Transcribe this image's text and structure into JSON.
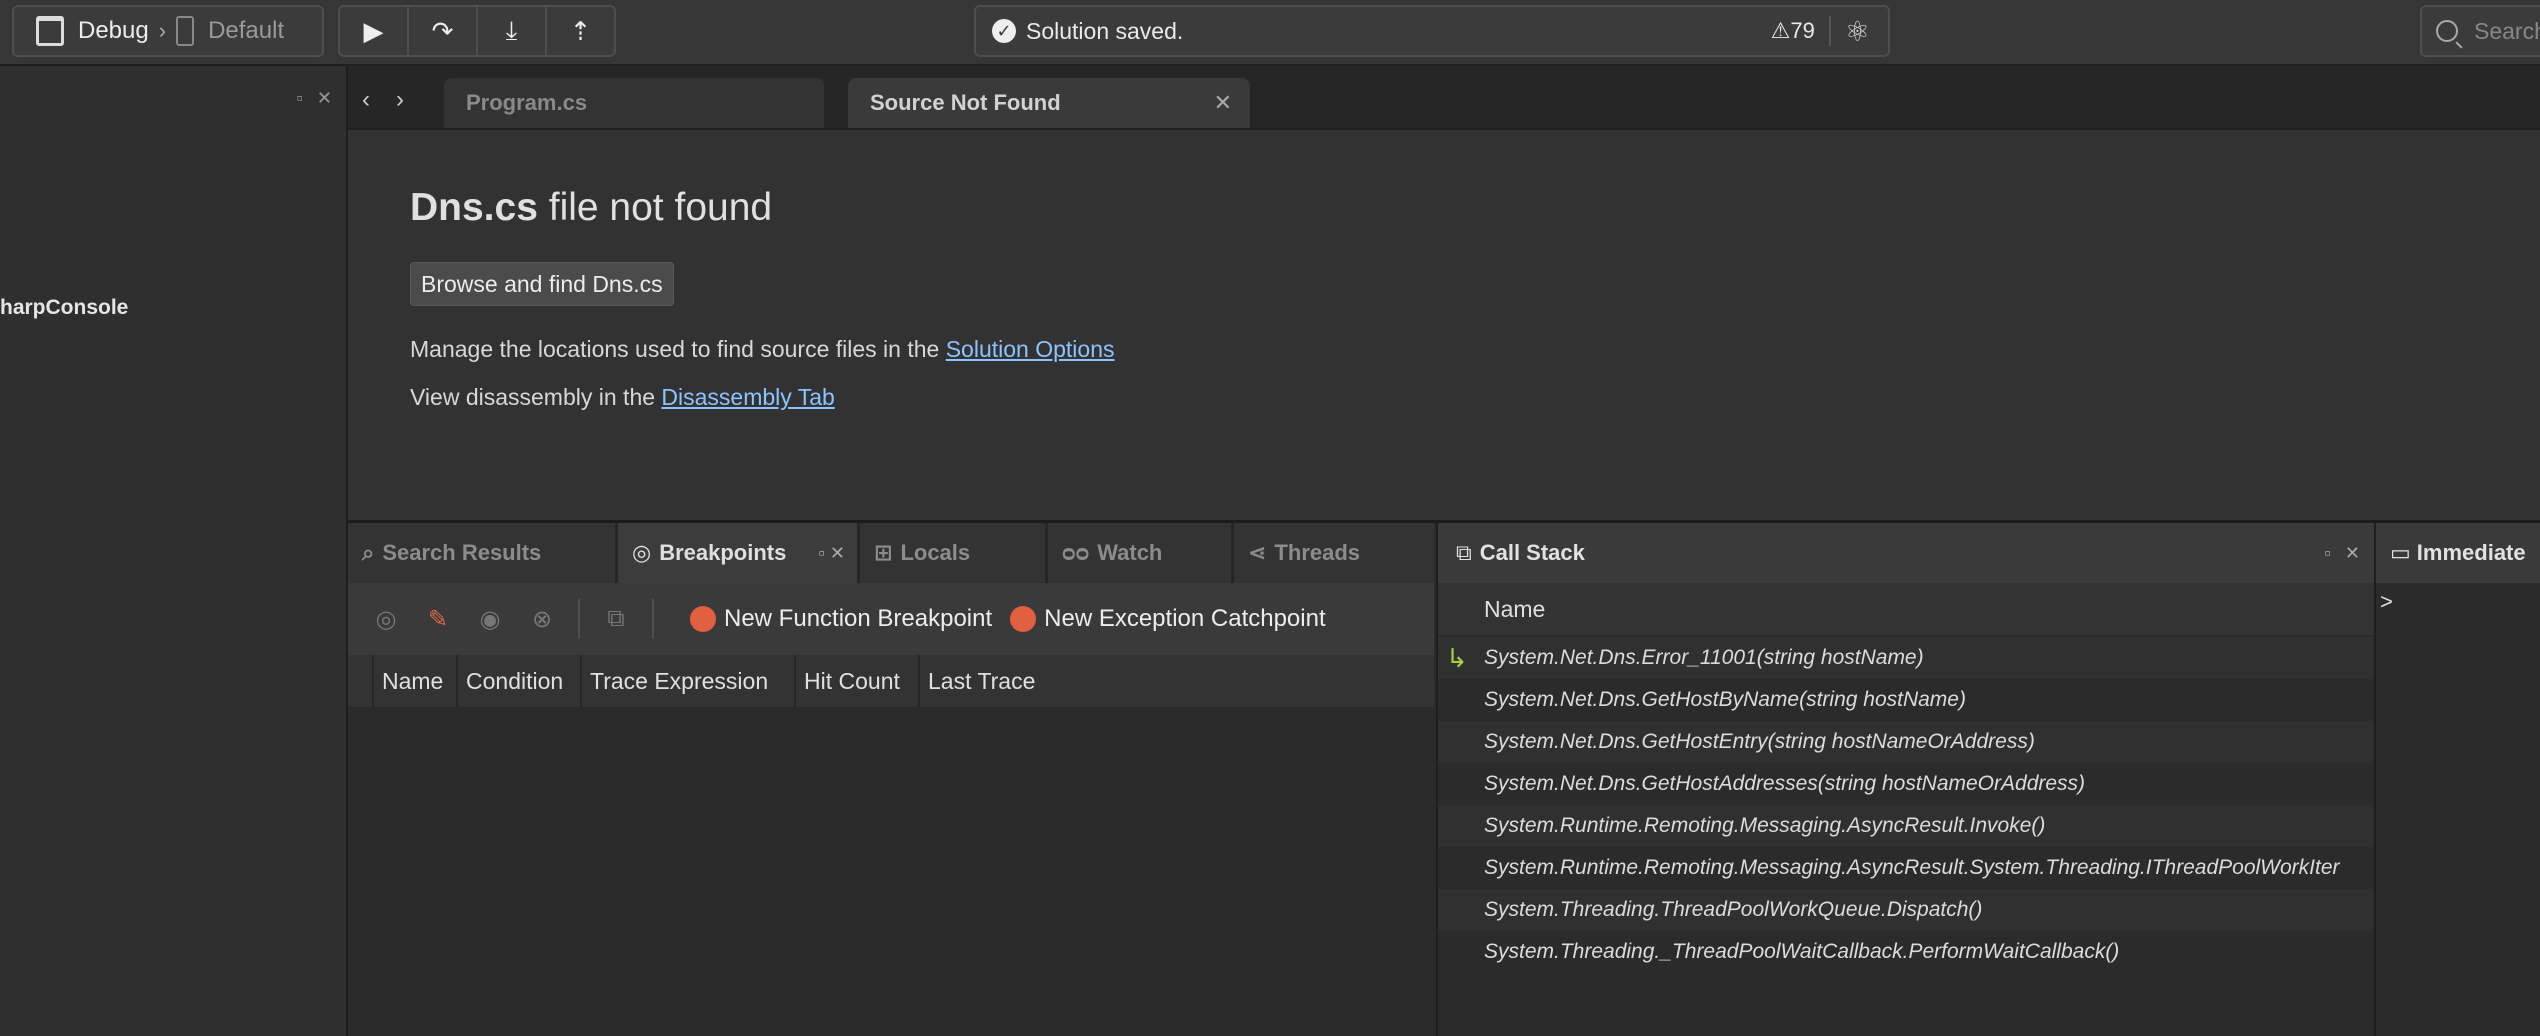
{
  "toolbar": {
    "config": "Debug",
    "device": "Default",
    "status_message": "Solution saved.",
    "warnings_count": "79",
    "search_placeholder": "Search"
  },
  "left_panel": {
    "project_label": "harpConsole"
  },
  "doc_tabs": [
    {
      "label": "Program.cs"
    },
    {
      "label": "Source Not Found"
    }
  ],
  "editor": {
    "filename": "Dns.cs",
    "title_rest": " file not found",
    "browse_button": "Browse and find Dns.cs",
    "manage_text": "Manage the locations used to find source files in the ",
    "manage_link": "Solution Options",
    "disasm_text": "View disassembly in the ",
    "disasm_link": "Disassembly Tab"
  },
  "pad_tabs": [
    {
      "label": "Search Results"
    },
    {
      "label": "Breakpoints"
    },
    {
      "label": "Locals"
    },
    {
      "label": "Watch"
    },
    {
      "label": "Threads"
    }
  ],
  "breakpoints": {
    "new_function": "New Function Breakpoint",
    "new_exception": "New Exception Catchpoint",
    "columns": [
      "Name",
      "Condition",
      "Trace Expression",
      "Hit Count",
      "Last Trace"
    ]
  },
  "call_stack": {
    "title": "Call Stack",
    "column": "Name",
    "frames": [
      "System.Net.Dns.Error_11001(string hostName)",
      "System.Net.Dns.GetHostByName(string hostName)",
      "System.Net.Dns.GetHostEntry(string hostNameOrAddress)",
      "System.Net.Dns.GetHostAddresses(string hostNameOrAddress)",
      "System.Runtime.Remoting.Messaging.AsyncResult.Invoke()",
      "System.Runtime.Remoting.Messaging.AsyncResult.System.Threading.IThreadPoolWorkIter",
      "System.Threading.ThreadPoolWorkQueue.Dispatch()",
      "System.Threading._ThreadPoolWaitCallback.PerformWaitCallback()"
    ]
  },
  "immediate": {
    "title": "Immediate",
    "prompt": ">"
  }
}
